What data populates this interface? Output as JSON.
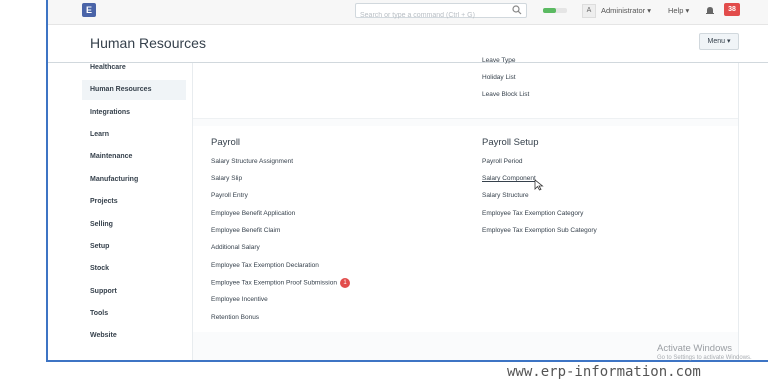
{
  "navbar": {
    "logo": "E",
    "search_placeholder": "Search or type a command (Ctrl + G)",
    "avatar": "A",
    "user": "Administrator",
    "help": "Help",
    "notifications": "38"
  },
  "header": {
    "title": "Human Resources",
    "menu": "Menu"
  },
  "sidebar": {
    "items": [
      {
        "label": "Healthcare"
      },
      {
        "label": "Human Resources",
        "active": true
      },
      {
        "label": "Integrations"
      },
      {
        "label": "Learn"
      },
      {
        "label": "Maintenance"
      },
      {
        "label": "Manufacturing"
      },
      {
        "label": "Projects"
      },
      {
        "label": "Selling"
      },
      {
        "label": "Setup"
      },
      {
        "label": "Stock"
      },
      {
        "label": "Support"
      },
      {
        "label": "Tools"
      },
      {
        "label": "Website"
      }
    ]
  },
  "top_links": [
    "Leave Type",
    "Holiday List",
    "Leave Block List"
  ],
  "payroll": {
    "title": "Payroll",
    "links": [
      "Salary Structure Assignment",
      "Salary Slip",
      "Payroll Entry",
      "Employee Benefit Application",
      "Employee Benefit Claim",
      "Additional Salary",
      "Employee Tax Exemption Declaration",
      "Employee Tax Exemption Proof Submission",
      "Employee Incentive",
      "Retention Bonus"
    ],
    "badge": "1"
  },
  "payroll_setup": {
    "title": "Payroll Setup",
    "links": [
      "Payroll Period",
      "Salary Component",
      "Salary Structure",
      "Employee Tax Exemption Category",
      "Employee Tax Exemption Sub Category"
    ]
  },
  "watermark": {
    "title": "Activate Windows",
    "subtitle": "Go to Settings to activate Windows."
  },
  "site": "www.erp-information.com",
  "colors": {
    "accent": "#4a64a8",
    "notification": "#e24c4b",
    "frame_border": "#3d74c4"
  }
}
